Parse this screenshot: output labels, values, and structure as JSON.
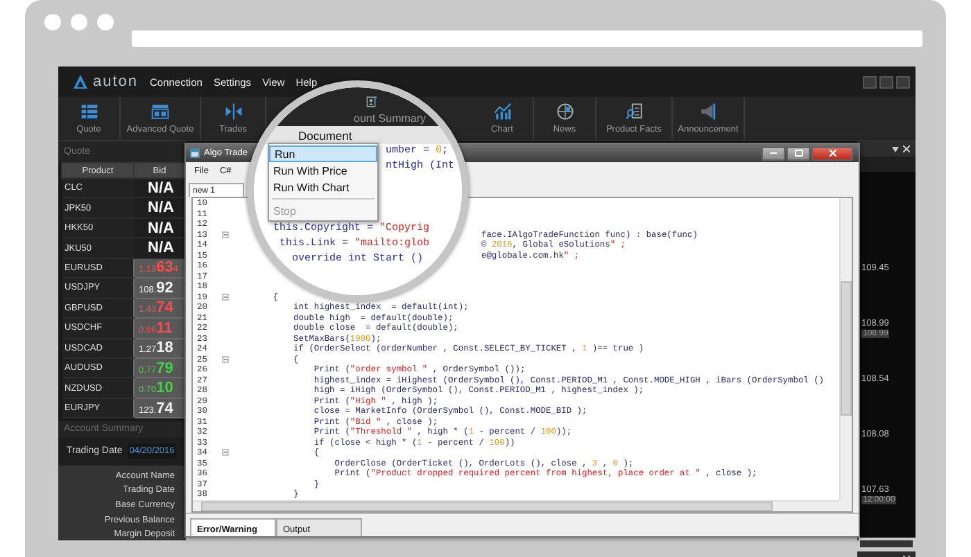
{
  "app": {
    "logo": "auton",
    "menu": [
      "Connection",
      "Settings",
      "View",
      "Help"
    ]
  },
  "toolbar": {
    "items_left": [
      {
        "label": "Quote",
        "kind": "list"
      },
      {
        "label": "Advanced Quote",
        "kind": "panels"
      },
      {
        "label": "Trades",
        "kind": "arrows"
      }
    ],
    "items_right": [
      {
        "label": "Chart",
        "kind": "chart"
      },
      {
        "label": "News",
        "kind": "globe"
      },
      {
        "label": "Product Facts",
        "kind": "doc-search"
      },
      {
        "label": "Announcement",
        "kind": "megaphone"
      }
    ]
  },
  "quote_panel": {
    "title": "Quote",
    "columns": [
      "Product",
      "Bid"
    ],
    "rows": [
      {
        "product": "CLC",
        "kind": "na",
        "bid": "N/A"
      },
      {
        "product": "JPK50",
        "kind": "na",
        "bid": "N/A"
      },
      {
        "product": "HKK50",
        "kind": "na",
        "bid": "N/A"
      },
      {
        "product": "JKU50",
        "kind": "na",
        "bid": "N/A"
      },
      {
        "product": "EURUSD",
        "kind": "price",
        "bid_small": "1.13",
        "bid_big": "63",
        "bid_tail": "4",
        "color": "#ff4a4a"
      },
      {
        "product": "USDJPY",
        "kind": "price",
        "bid_small": "108.",
        "bid_big": "92",
        "color": "#f0f0f0"
      },
      {
        "product": "GBPUSD",
        "kind": "price",
        "bid_small": "1.43",
        "bid_big": "74",
        "color": "#ff4a4a"
      },
      {
        "product": "USDCHF",
        "kind": "price",
        "bid_small": "0.96",
        "bid_big": "11",
        "color": "#ff4a4a"
      },
      {
        "product": "USDCAD",
        "kind": "price",
        "bid_small": "1.27",
        "bid_big": "18",
        "color": "#f0f0f0"
      },
      {
        "product": "AUDUSD",
        "kind": "price",
        "bid_small": "0.77",
        "bid_big": "79",
        "color": "#3fd43f"
      },
      {
        "product": "NZDUSD",
        "kind": "price",
        "bid_small": "0.70",
        "bid_big": "10",
        "color": "#3fd43f"
      },
      {
        "product": "EURJPY",
        "kind": "price",
        "bid_small": "123.",
        "bid_big": "74",
        "color": "#f0f0f0"
      }
    ]
  },
  "account_summary": {
    "title": "Account Summary",
    "trading_date": {
      "label": "Trading Date",
      "value": "04/20/2016"
    },
    "fields": [
      "Account Name",
      "Trading Date",
      "Base Currency",
      "Previous Balance",
      "Margin Deposit"
    ]
  },
  "algo_window": {
    "title": "Algo Trade",
    "menu": [
      "File",
      "C#"
    ],
    "tab": "new 1",
    "lines": [
      {
        "number": "10",
        "kind": "empty",
        "fold": false
      },
      {
        "number": "11",
        "kind": "empty",
        "fold": false
      },
      {
        "number": "12",
        "kind": "empty",
        "fold": false
      },
      {
        "number": "13",
        "kind": "tail",
        "fold": true,
        "text": "face.IAlgoTradeFunction func) : base(func)"
      },
      {
        "number": "14",
        "kind": "tail",
        "fold": false,
        "text": "© 2016, Global eSolutions\" ;"
      },
      {
        "number": "15",
        "kind": "tail",
        "fold": false,
        "text": "e@globale.com.hk\" ;"
      },
      {
        "number": "16",
        "kind": "empty",
        "fold": false
      },
      {
        "number": "17",
        "kind": "empty",
        "fold": false
      },
      {
        "number": "18",
        "kind": "empty",
        "fold": false
      },
      {
        "number": "19",
        "kind": "code",
        "fold": true,
        "text": "        {"
      },
      {
        "number": "20",
        "kind": "code",
        "fold": false,
        "text": "            int highest_index  = default(int);"
      },
      {
        "number": "21",
        "kind": "code",
        "fold": false,
        "text": "            double high  = default(double);"
      },
      {
        "number": "22",
        "kind": "code",
        "fold": false,
        "text": "            double close  = default(double);"
      },
      {
        "number": "23",
        "kind": "code",
        "fold": false,
        "text": "            SetMaxBars(1000);"
      },
      {
        "number": "24",
        "kind": "code",
        "fold": false,
        "text": "            if (OrderSelect (orderNumber , Const.SELECT_BY_TICKET , 1 )== true )"
      },
      {
        "number": "25",
        "kind": "code",
        "fold": true,
        "text": "            {"
      },
      {
        "number": "26",
        "kind": "code",
        "fold": false,
        "text": "                Print (\"order symbol \" , OrderSymbol ());"
      },
      {
        "number": "27",
        "kind": "code",
        "fold": false,
        "text": "                highest_index = iHighest (OrderSymbol (), Const.PERIOD_M1 , Const.MODE_HIGH , iBars (OrderSymbol ()"
      },
      {
        "number": "28",
        "kind": "code",
        "fold": false,
        "text": "                high = iHigh (OrderSymbol (), Const.PERIOD_M1 , highest_index );"
      },
      {
        "number": "29",
        "kind": "code",
        "fold": false,
        "text": "                Print (\"High \" , high );"
      },
      {
        "number": "30",
        "kind": "code",
        "fold": false,
        "text": "                close = MarketInfo (OrderSymbol (), Const.MODE_BID );"
      },
      {
        "number": "31",
        "kind": "code",
        "fold": false,
        "text": "                Print (\"Bid \" , close );"
      },
      {
        "number": "32",
        "kind": "code",
        "fold": false,
        "text": "                Print (\"Threshold \" , high * (1 - percent / 100));"
      },
      {
        "number": "33",
        "kind": "code",
        "fold": false,
        "text": "                if (close < high * (1 - percent / 100))"
      },
      {
        "number": "34",
        "kind": "code",
        "fold": true,
        "text": "                {"
      },
      {
        "number": "35",
        "kind": "code",
        "fold": false,
        "text": "                    OrderClose (OrderTicket (), OrderLots (), close , 3 , 0 );"
      },
      {
        "number": "36",
        "kind": "code",
        "fold": false,
        "text": "                    Print (\"Product dropped required percent from highest, place order at \" , close );"
      },
      {
        "number": "37",
        "kind": "code",
        "fold": false,
        "text": "                }"
      },
      {
        "number": "38",
        "kind": "code",
        "fold": false,
        "text": "            }"
      }
    ],
    "bottom_tabs": [
      {
        "label": "Error/Warning",
        "selected": true
      },
      {
        "label": "Output",
        "selected": false
      }
    ]
  },
  "chart_panel": {
    "price_labels": [
      "109.45",
      "108.99",
      "108.54",
      "108.08",
      "107.63"
    ],
    "price_marker": "108.99",
    "time_label": "12:00:00"
  },
  "magnifier": {
    "toolbar_label": "ount Summary",
    "menu_title": "Document",
    "menu_items": [
      {
        "label": "Run",
        "selected": true,
        "disabled": false
      },
      {
        "label": "Run With Price",
        "selected": false,
        "disabled": false
      },
      {
        "label": "Run With Chart",
        "selected": false,
        "disabled": false
      },
      {
        "label": "Stop",
        "selected": false,
        "disabled": true
      }
    ],
    "code": [
      {
        "kind": "code",
        "text": "                  umber = 0;"
      },
      {
        "kind": "code",
        "text": "                  ntHigh (Int"
      },
      {
        "kind": "blank"
      },
      {
        "kind": "blank"
      },
      {
        "kind": "blank"
      },
      {
        "kind": "code",
        "text": "this.Copyright = \"Copyrig"
      },
      {
        "kind": "code",
        "text": " this.Link = \"mailto:glob"
      },
      {
        "kind": "code",
        "text": "   override int Start ()"
      }
    ]
  }
}
